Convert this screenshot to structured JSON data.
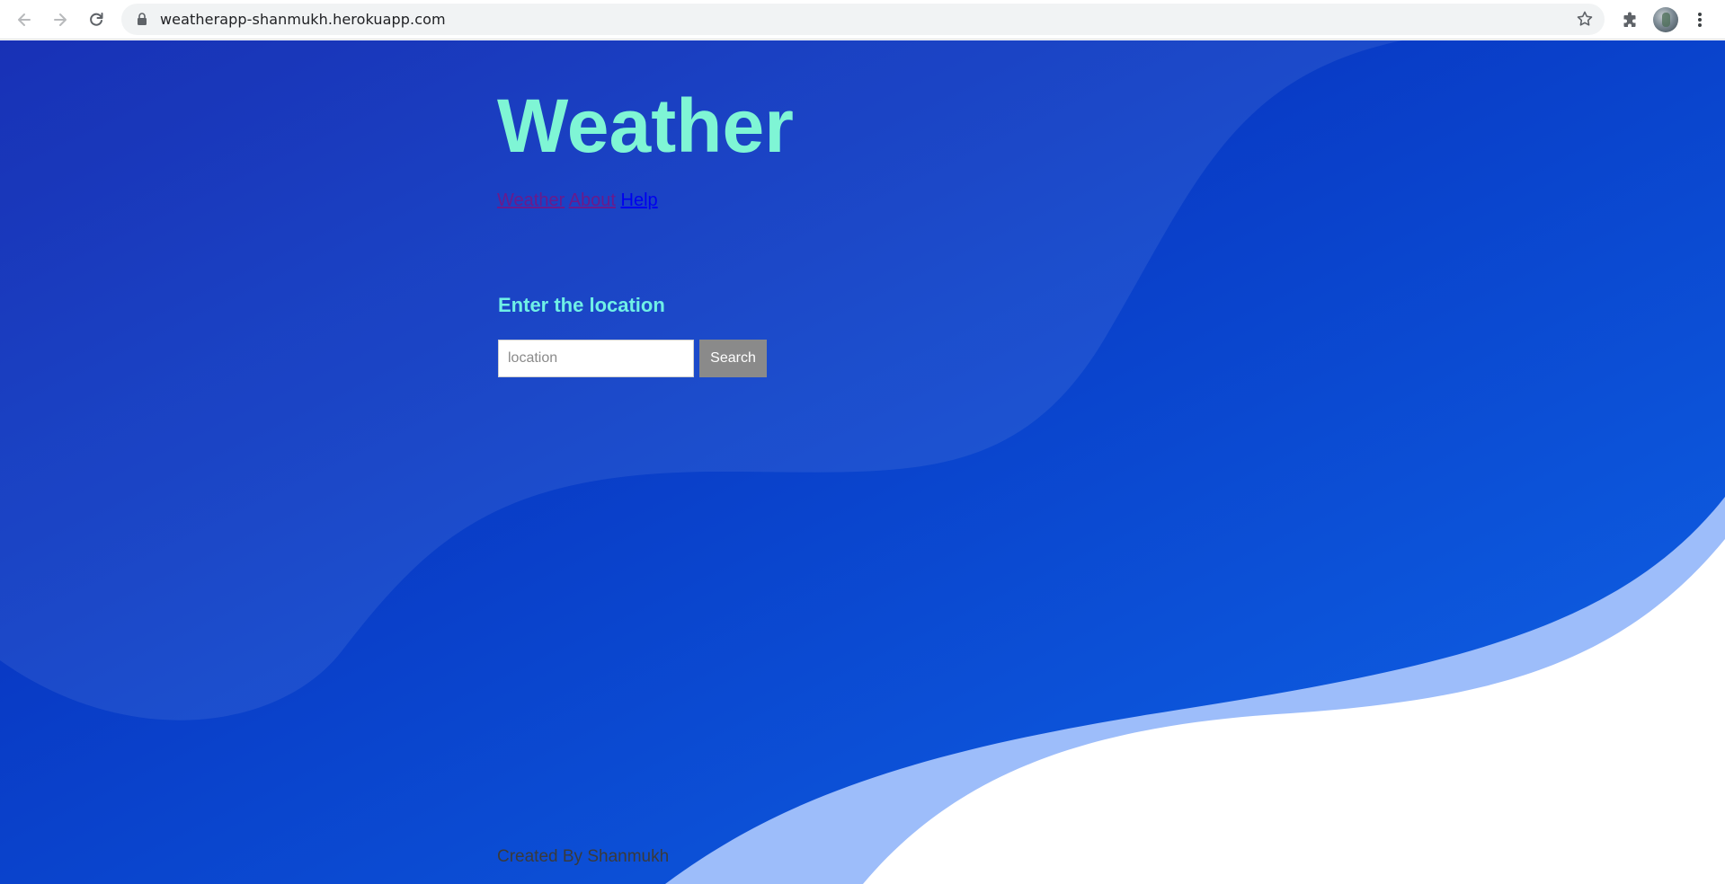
{
  "browser": {
    "url": "weatherapp-shanmukh.herokuapp.com",
    "icons": [
      "back-arrow-icon",
      "forward-arrow-icon",
      "reload-icon",
      "lock-icon",
      "star-icon",
      "puzzle-extension-icon",
      "menu-kebab-icon"
    ]
  },
  "page": {
    "title": "Weather",
    "nav": {
      "weather": "Weather",
      "about": "About",
      "help": "Help"
    },
    "prompt": "Enter the location",
    "search": {
      "placeholder": "location",
      "value": "",
      "button_label": "Search"
    },
    "footer": "Created By Shanmukh"
  },
  "colors": {
    "title": "#7ff5d5",
    "prompt": "#6ff0e6",
    "background_start": "#0520b0",
    "background_end": "#0f66e8",
    "light_wave": "#9dbdfa",
    "visited_link": "#6a1a8c",
    "link": "#0000ee",
    "button_bg": "#8a8a8a"
  }
}
